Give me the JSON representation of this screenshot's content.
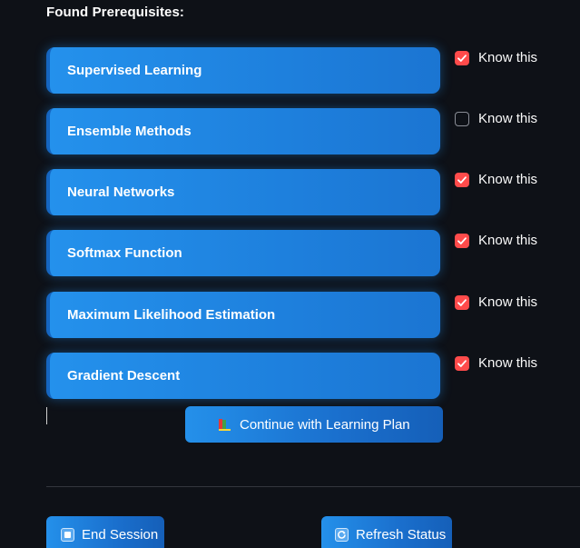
{
  "heading": "Found Prerequisites:",
  "prerequisites": [
    {
      "label": "Supervised Learning",
      "know_label": "Know this",
      "checked": true
    },
    {
      "label": "Ensemble Methods",
      "know_label": "Know this",
      "checked": false
    },
    {
      "label": "Neural Networks",
      "know_label": "Know this",
      "checked": true
    },
    {
      "label": "Softmax Function",
      "know_label": "Know this",
      "checked": true
    },
    {
      "label": "Maximum Likelihood Estimation",
      "know_label": "Know this",
      "checked": true
    },
    {
      "label": "Gradient Descent",
      "know_label": "Know this",
      "checked": true
    }
  ],
  "buttons": {
    "continue": {
      "label": "Continue with Learning Plan",
      "icon": "books-icon"
    },
    "end_session": {
      "label": "End Session",
      "icon": "stop-icon"
    },
    "refresh": {
      "label": "Refresh Status",
      "icon": "refresh-icon"
    }
  },
  "colors": {
    "background": "#0e1117",
    "card": "#1e88e5",
    "checkbox_checked": "#ff4b4b",
    "button": "#1a6fcd"
  }
}
